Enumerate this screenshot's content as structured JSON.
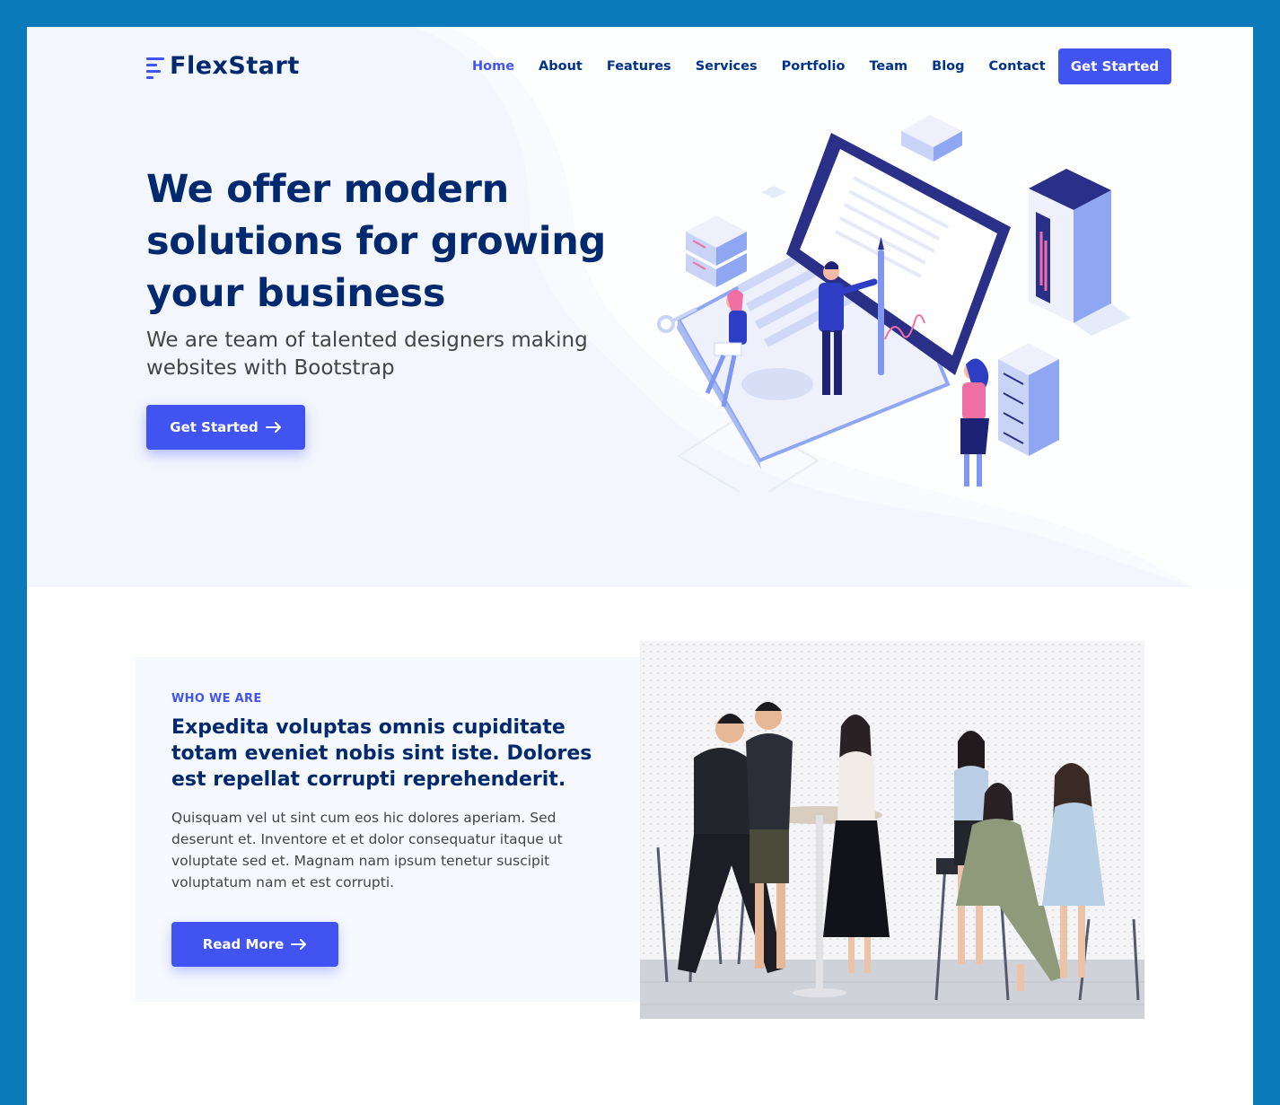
{
  "brand": {
    "name": "FlexStart",
    "accent": "#4154f1",
    "dark": "#012970"
  },
  "nav": {
    "items": [
      "Home",
      "About",
      "Features",
      "Services",
      "Portfolio",
      "Team",
      "Blog",
      "Contact"
    ],
    "active": "Home",
    "cta_label": "Get Started"
  },
  "hero": {
    "title": "We offer modern solutions for growing your business",
    "subtitle": "We are team of talented designers making websites with Bootstrap",
    "button_label": "Get Started",
    "button_icon": "arrow-right-icon",
    "illustration": "isometric-laptop-team-illustration"
  },
  "about": {
    "eyebrow": "WHO WE ARE",
    "heading": "Expedita voluptas omnis cupiditate totam eveniet nobis sint iste. Dolores est repellat corrupti reprehenderit.",
    "body": "Quisquam vel ut sint cum eos hic dolores aperiam. Sed deserunt et. Inventore et et dolor consequatur itaque ut voluptate sed et. Magnam nam ipsum tenetur suscipit voluptatum nam et est corrupti.",
    "button_label": "Read More",
    "button_icon": "arrow-right-icon",
    "photo": "team-meeting-photo"
  }
}
